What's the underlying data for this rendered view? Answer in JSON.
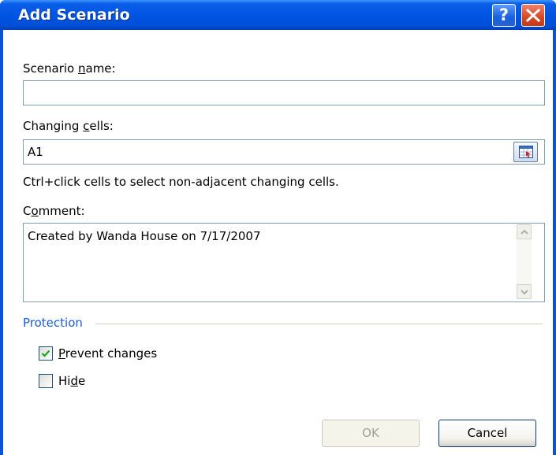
{
  "dialog": {
    "title": "Add Scenario",
    "help_glyph": "?",
    "close_icon": "close-icon"
  },
  "scenario_name": {
    "label_pre": "Scenario ",
    "label_key": "n",
    "label_post": "ame:",
    "value": ""
  },
  "changing_cells": {
    "label_pre": "Changing ",
    "label_key": "c",
    "label_post": "ells:",
    "value": "A1",
    "hint": "Ctrl+click cells to select non-adjacent changing cells.",
    "ref_icon": "collapse-dialog-icon"
  },
  "comment": {
    "label_pre": "C",
    "label_key": "o",
    "label_post": "mment:",
    "value": "Created by Wanda House on 7/17/2007"
  },
  "protection": {
    "heading": "Protection",
    "prevent_changes": {
      "label_key": "P",
      "label_post": "revent changes",
      "checked": true
    },
    "hide": {
      "label_pre": "Hi",
      "label_key": "d",
      "label_post": "e",
      "checked": false
    }
  },
  "buttons": {
    "ok": "OK",
    "cancel": "Cancel"
  },
  "colors": {
    "title_bar": "#0054e3",
    "group_heading": "#1c5dd6",
    "close_button": "#d94722"
  }
}
